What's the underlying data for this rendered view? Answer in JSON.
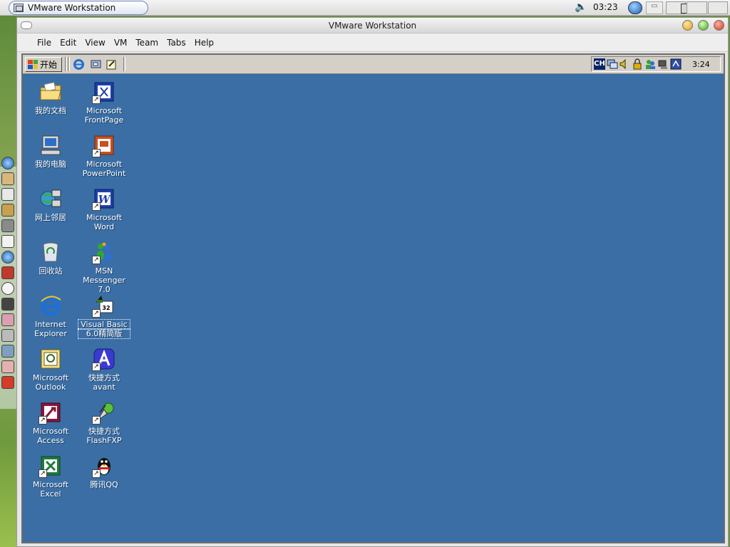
{
  "host": {
    "taskbar_button": "VMware Workstation",
    "clock": "03:23"
  },
  "window": {
    "title": "VMware Workstation",
    "menu": [
      "File",
      "Edit",
      "View",
      "VM",
      "Team",
      "Tabs",
      "Help"
    ]
  },
  "guest": {
    "start_label": "开始",
    "clock": "3:24",
    "tray_input": "CH"
  },
  "desktop": {
    "background_color": "#3a6ea5",
    "icons": [
      {
        "line1": "我的文档",
        "line2": ""
      },
      {
        "line1": "Microsoft",
        "line2": "FrontPage"
      },
      {
        "line1": "我的电脑",
        "line2": ""
      },
      {
        "line1": "Microsoft",
        "line2": "PowerPoint"
      },
      {
        "line1": "网上邻居",
        "line2": ""
      },
      {
        "line1": "Microsoft",
        "line2": "Word"
      },
      {
        "line1": "回收站",
        "line2": ""
      },
      {
        "line1": "MSN",
        "line2": "Messenger 7.0"
      },
      {
        "line1": "Internet",
        "line2": "Explorer"
      },
      {
        "line1": "Visual Basic",
        "line2": "6.0精简版"
      },
      {
        "line1": "Microsoft",
        "line2": "Outlook"
      },
      {
        "line1": "快捷方式",
        "line2": "avant"
      },
      {
        "line1": "Microsoft",
        "line2": "Access"
      },
      {
        "line1": "快捷方式",
        "line2": "FlashFXP"
      },
      {
        "line1": "Microsoft",
        "line2": "Excel"
      },
      {
        "line1": "腾讯QQ",
        "line2": ""
      }
    ]
  }
}
